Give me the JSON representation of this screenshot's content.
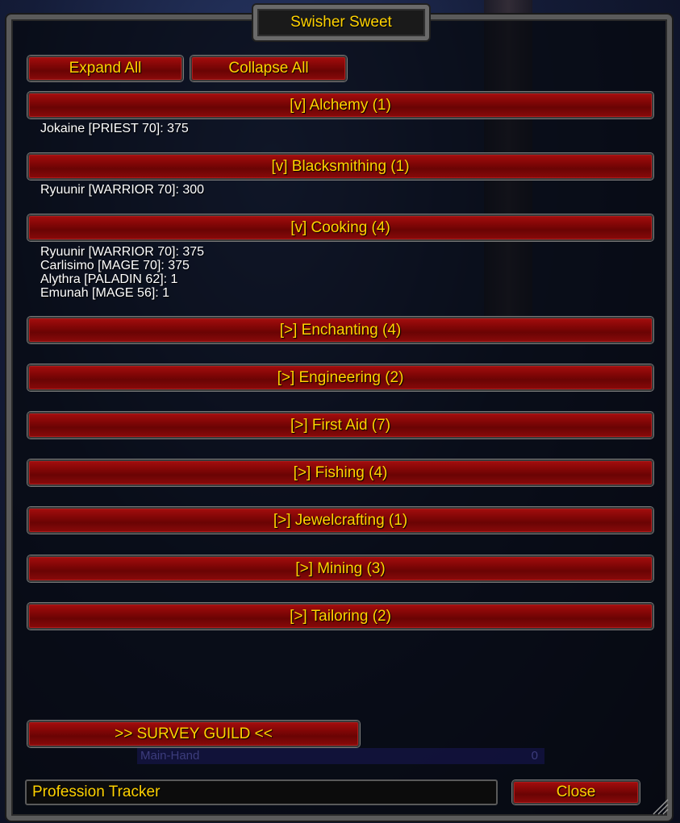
{
  "window": {
    "title": "Swisher Sweet"
  },
  "toolbar": {
    "expand_label": "Expand All",
    "collapse_label": "Collapse All"
  },
  "professions": [
    {
      "header": "[v] Alchemy (1)",
      "members": [
        "Jokaine [PRIEST 70]: 375"
      ]
    },
    {
      "header": "[v] Blacksmithing (1)",
      "members": [
        "Ryuunir [WARRIOR 70]: 300"
      ]
    },
    {
      "header": "[v] Cooking (4)",
      "members": [
        "Ryuunir [WARRIOR 70]: 375",
        "Carlisimo [MAGE 70]: 375",
        "Alythra [PALADIN 62]: 1",
        "Emunah [MAGE 56]: 1"
      ]
    },
    {
      "header": "[>] Enchanting (4)"
    },
    {
      "header": "[>] Engineering (2)"
    },
    {
      "header": "[>] First Aid (7)"
    },
    {
      "header": "[>] Fishing (4)"
    },
    {
      "header": "[>] Jewelcrafting (1)"
    },
    {
      "header": "[>] Mining (3)"
    },
    {
      "header": "[>] Tailoring (2)"
    }
  ],
  "survey": {
    "label": ">> SURVEY GUILD <<"
  },
  "background_status": {
    "label": "Main-Hand",
    "value": "0"
  },
  "footer": {
    "title_value": "Profession Tracker",
    "close_label": "Close"
  },
  "colors": {
    "button_red": "#8a0a0a",
    "gold_text": "#ffd200",
    "white_text": "#ffffff"
  }
}
